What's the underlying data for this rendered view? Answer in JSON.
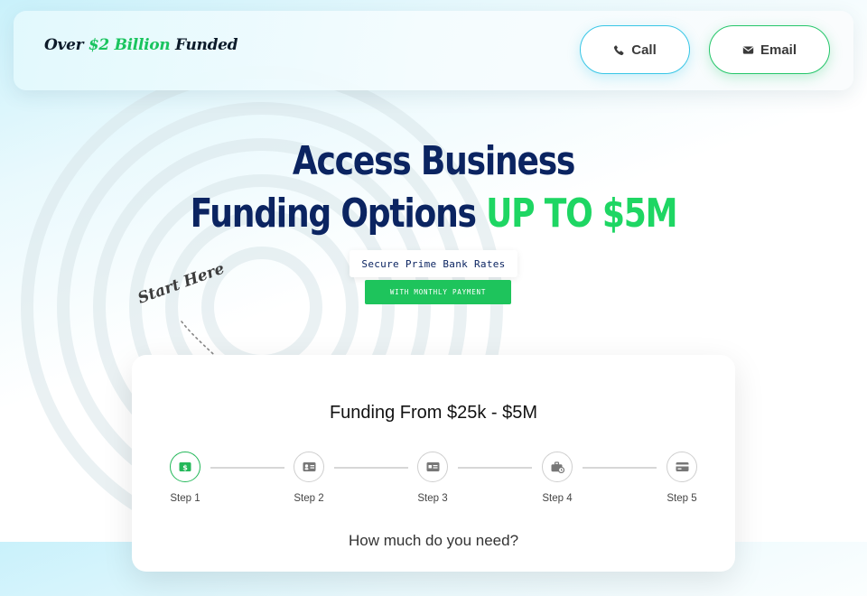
{
  "header": {
    "logo": {
      "prefix": "Over ",
      "accent": "$2 Billion",
      "suffix": " Funded"
    },
    "call_label": "Call",
    "email_label": "Email"
  },
  "hero": {
    "title_line1": "Access Business",
    "title_line2": "Funding Options ",
    "title_accent": "UP TO $5M",
    "badge_primary": "Secure Prime Bank Rates",
    "badge_secondary": "WITH MONTHLY PAYMENT",
    "start_here": "Start Here"
  },
  "form": {
    "title": "Funding From $25k - $5M",
    "steps": [
      {
        "label": "Step 1",
        "icon": "dollar-bill-icon",
        "active": true
      },
      {
        "label": "Step 2",
        "icon": "id-card-icon",
        "active": false
      },
      {
        "label": "Step 3",
        "icon": "credit-card-id-icon",
        "active": false
      },
      {
        "label": "Step 4",
        "icon": "briefcase-clock-icon",
        "active": false
      },
      {
        "label": "Step 5",
        "icon": "credit-card-icon",
        "active": false
      }
    ],
    "question": "How much do you need?"
  },
  "colors": {
    "navy": "#0b2461",
    "green": "#1ed663",
    "call_border": "#38c6e6",
    "email_border": "#25c66a"
  }
}
